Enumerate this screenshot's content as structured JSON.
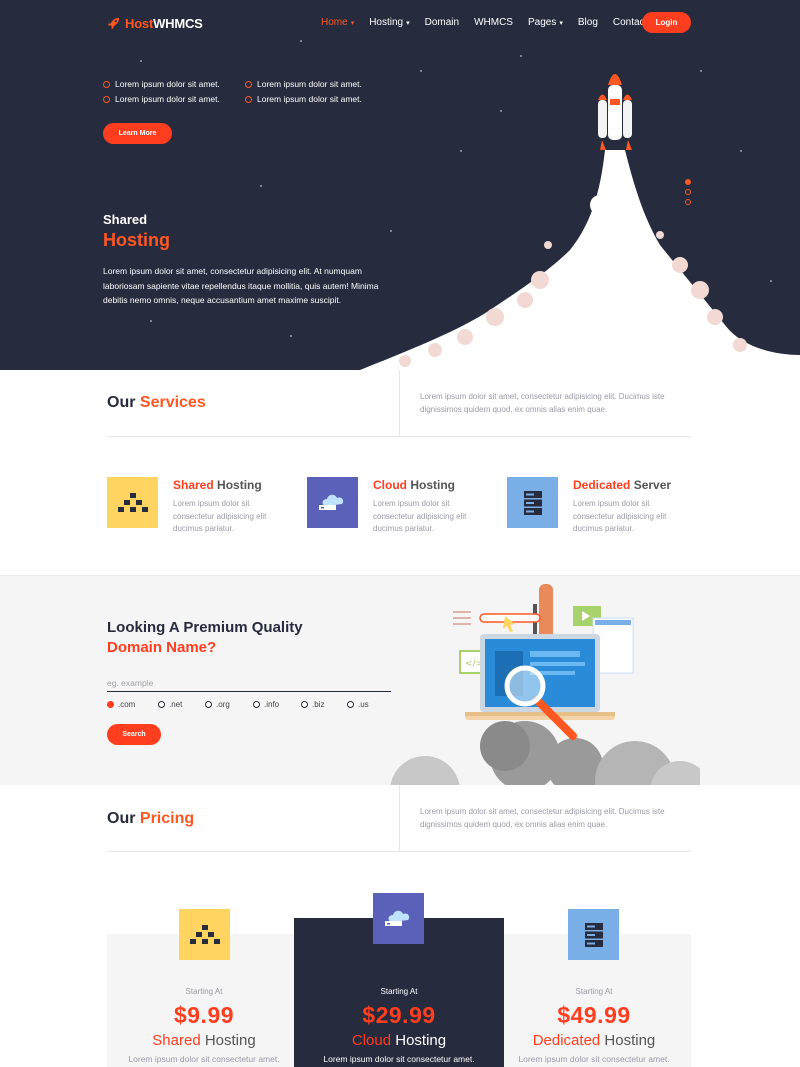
{
  "brand": {
    "part1": "Host",
    "part2": "WHMCS"
  },
  "nav": {
    "items": [
      {
        "label": "Home",
        "caret": "▾"
      },
      {
        "label": "Hosting",
        "caret": "▾"
      },
      {
        "label": "Domain",
        "caret": ""
      },
      {
        "label": "WHMCS",
        "caret": ""
      },
      {
        "label": "Pages",
        "caret": "▾"
      },
      {
        "label": "Blog",
        "caret": ""
      },
      {
        "label": "Contact",
        "caret": ""
      }
    ],
    "login": "Login"
  },
  "hero": {
    "checks": [
      "Lorem ipsum dolor sit amet.",
      "Lorem ipsum dolor sit amet.",
      "Lorem ipsum dolor sit amet.",
      "Lorem ipsum dolor sit amet."
    ],
    "learn_more": "Learn More",
    "title_line1": "Shared",
    "title_line2": "Hosting",
    "paragraph": "Lorem ipsum dolor sit amet, consectetur adipisicing elit. At numquam laboriosam sapiente vitae repellendus itaque mollitia, quis autem! Minima debitis nemo omnis, neque accusantium amet maxime suscipit."
  },
  "services": {
    "title_a": "Our ",
    "title_b": "Services",
    "desc": "Lorem ipsum dolor sit amet, consectetur adipisicing elit. Ducimus iste dignissimos quidem quod, ex omnis alias enim quae.",
    "items": [
      {
        "title_a": "Shared",
        "title_b": " Hosting",
        "desc": "Lorem ipsum dolor sit consectetur adipisicing elit ducimus pariatur.",
        "icon": "pyramid-icon"
      },
      {
        "title_a": "Cloud",
        "title_b": " Hosting",
        "desc": "Lorem ipsum dolor sit consectetur adipisicing elit ducimus pariatur.",
        "icon": "cloud-server-icon"
      },
      {
        "title_a": "Dedicated",
        "title_b": " Server",
        "desc": "Lorem ipsum dolor sit consectetur adipisicing elit ducimus pariatur.",
        "icon": "server-rack-icon"
      }
    ]
  },
  "domain": {
    "title_line1": "Looking A Premium Quality",
    "title_line2": "Domain Name?",
    "placeholder": "eg. example",
    "tlds": [
      ".com",
      ".net",
      ".org",
      ".info",
      ".biz",
      ".us"
    ],
    "selected": ".com",
    "search": "Search"
  },
  "pricing": {
    "title_a": "Our ",
    "title_b": "Pricing",
    "desc": "Lorem ipsum dolor sit amet, consectetur adipisicing elit. Ducimus iste dignissimos quidem quod, ex omnis alias enim quae.",
    "plans": [
      {
        "starting": "Starting At",
        "price": "$9.99",
        "name_a": "Shared",
        "name_b": " Hosting",
        "desc": "Lorem ipsum dolor sit consectetur amet."
      },
      {
        "starting": "Starting At",
        "price": "$29.99",
        "name_a": "Cloud",
        "name_b": " Hosting",
        "desc": "Lorem ipsum dolor sit consectetur amet."
      },
      {
        "starting": "Starting At",
        "price": "$49.99",
        "name_a": "Dedicated",
        "name_b": " Hosting",
        "desc": "Lorem ipsum dolor sit consectetur amet."
      }
    ]
  },
  "colors": {
    "accent": "#ff3d1f",
    "dark": "#262b3d",
    "yellow": "#ffd460",
    "purple": "#5b61b8",
    "blue": "#7aaee6"
  }
}
